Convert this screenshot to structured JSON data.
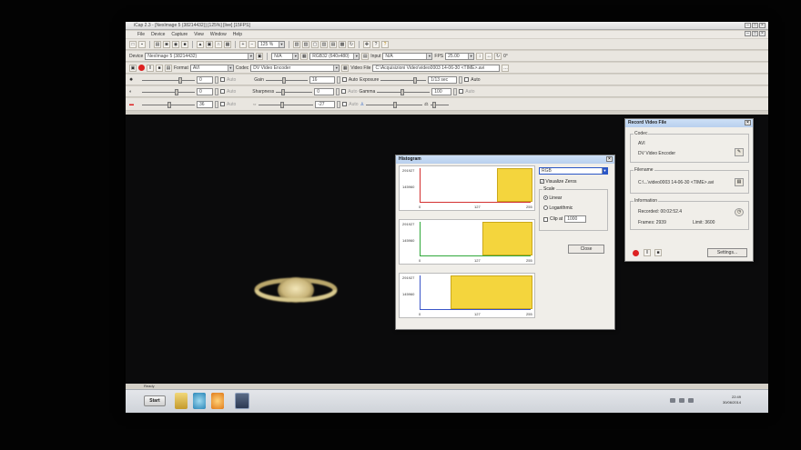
{
  "app": {
    "title": "iCap 2.3 - [NexImage 5 (38214432)] [125%] [live] [15FPS]",
    "menu": [
      "File",
      "Device",
      "Capture",
      "View",
      "Window",
      "Help"
    ],
    "zoom": "125 %",
    "device_label": "Device",
    "device_value": "NexImage 5 (38214432)",
    "na_value": "N/A",
    "video_format": "RGB32 (640x480)",
    "input_label": "Input",
    "input_value": "N/A",
    "fps_label": "FPS",
    "fps_value": "25.00",
    "angle_value": "0°",
    "format_label": "Format",
    "format_value": "AVI",
    "codec_label": "Codec",
    "codec_value": "DV Video Encoder",
    "video_file_label": "Video File",
    "video_file_value": "C:\\Acquisizioni Video\\video0003 14-06-30 <TIME>.avi",
    "gain_label": "Gain",
    "gain_value": "16",
    "auto_label": "Auto",
    "exposure_label": "Exposure",
    "exposure_value": "1/13 sec",
    "sharpness_label": "Sharpness",
    "sharpness_value": "0",
    "gamma_label": "Gamma",
    "gamma_value": "100",
    "brightness_value": "0",
    "contrast_value": "0",
    "saturation_value": "36",
    "hue_value": "-27"
  },
  "histogram": {
    "title": "Histogram",
    "channel": "RGB",
    "visualize_zeros": "Visualize Zeros",
    "scale_label": "Scale",
    "linear": "Linear",
    "logarithmic": "Logarithmic",
    "clip_at": "Clip at",
    "clip_value": "1000",
    "close": "Close",
    "panels": [
      {
        "ytop": "291927",
        "ymid": "145960",
        "x0": "0",
        "xmid": "127",
        "xmax": "255",
        "axis_color": "#d33030",
        "bar_start": 0.68,
        "bar_end": 1.0,
        "bar_height": 0.92
      },
      {
        "ytop": "291927",
        "ymid": "145960",
        "x0": "0",
        "xmid": "127",
        "xmax": "255",
        "axis_color": "#2fa83a",
        "bar_start": 0.55,
        "bar_end": 1.0,
        "bar_height": 0.92
      },
      {
        "ytop": "291927",
        "ymid": "145960",
        "x0": "0",
        "xmid": "127",
        "xmax": "255",
        "axis_color": "#3a55c8",
        "bar_start": 0.27,
        "bar_end": 1.0,
        "bar_height": 0.92
      }
    ]
  },
  "record": {
    "title": "Record Video File",
    "codec_label": "Codec",
    "codec_format": "AVI",
    "codec_name": "DV Video Encoder",
    "filename_label": "Filename",
    "filename_value": "C:\\...\\video0003 14-06-30 <TIME>.avi",
    "information_label": "Information",
    "recorded": "Recorded: 00:02:52.4",
    "frames": "Frames: 2939",
    "limit": "Limit: 3600",
    "settings": "Settings..."
  },
  "status": {
    "ready": "Ready"
  },
  "taskbar": {
    "start": "Start",
    "time": "22:49",
    "date": "30/06/2014"
  }
}
